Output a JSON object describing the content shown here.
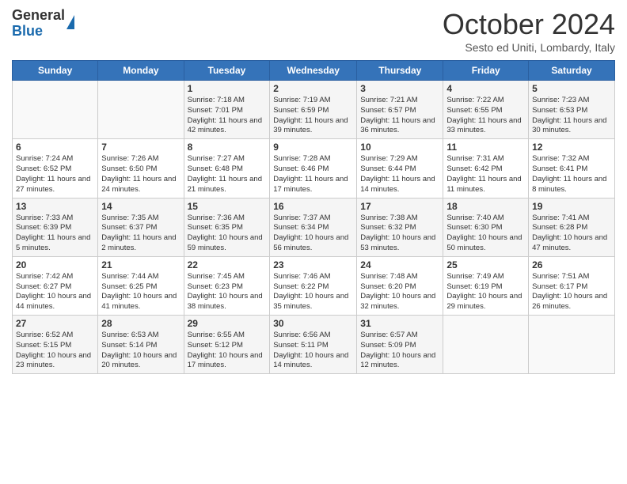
{
  "header": {
    "logo_general": "General",
    "logo_blue": "Blue",
    "month_title": "October 2024",
    "subtitle": "Sesto ed Uniti, Lombardy, Italy"
  },
  "days_of_week": [
    "Sunday",
    "Monday",
    "Tuesday",
    "Wednesday",
    "Thursday",
    "Friday",
    "Saturday"
  ],
  "weeks": [
    [
      {
        "day": "",
        "info": ""
      },
      {
        "day": "",
        "info": ""
      },
      {
        "day": "1",
        "info": "Sunrise: 7:18 AM\nSunset: 7:01 PM\nDaylight: 11 hours and 42 minutes."
      },
      {
        "day": "2",
        "info": "Sunrise: 7:19 AM\nSunset: 6:59 PM\nDaylight: 11 hours and 39 minutes."
      },
      {
        "day": "3",
        "info": "Sunrise: 7:21 AM\nSunset: 6:57 PM\nDaylight: 11 hours and 36 minutes."
      },
      {
        "day": "4",
        "info": "Sunrise: 7:22 AM\nSunset: 6:55 PM\nDaylight: 11 hours and 33 minutes."
      },
      {
        "day": "5",
        "info": "Sunrise: 7:23 AM\nSunset: 6:53 PM\nDaylight: 11 hours and 30 minutes."
      }
    ],
    [
      {
        "day": "6",
        "info": "Sunrise: 7:24 AM\nSunset: 6:52 PM\nDaylight: 11 hours and 27 minutes."
      },
      {
        "day": "7",
        "info": "Sunrise: 7:26 AM\nSunset: 6:50 PM\nDaylight: 11 hours and 24 minutes."
      },
      {
        "day": "8",
        "info": "Sunrise: 7:27 AM\nSunset: 6:48 PM\nDaylight: 11 hours and 21 minutes."
      },
      {
        "day": "9",
        "info": "Sunrise: 7:28 AM\nSunset: 6:46 PM\nDaylight: 11 hours and 17 minutes."
      },
      {
        "day": "10",
        "info": "Sunrise: 7:29 AM\nSunset: 6:44 PM\nDaylight: 11 hours and 14 minutes."
      },
      {
        "day": "11",
        "info": "Sunrise: 7:31 AM\nSunset: 6:42 PM\nDaylight: 11 hours and 11 minutes."
      },
      {
        "day": "12",
        "info": "Sunrise: 7:32 AM\nSunset: 6:41 PM\nDaylight: 11 hours and 8 minutes."
      }
    ],
    [
      {
        "day": "13",
        "info": "Sunrise: 7:33 AM\nSunset: 6:39 PM\nDaylight: 11 hours and 5 minutes."
      },
      {
        "day": "14",
        "info": "Sunrise: 7:35 AM\nSunset: 6:37 PM\nDaylight: 11 hours and 2 minutes."
      },
      {
        "day": "15",
        "info": "Sunrise: 7:36 AM\nSunset: 6:35 PM\nDaylight: 10 hours and 59 minutes."
      },
      {
        "day": "16",
        "info": "Sunrise: 7:37 AM\nSunset: 6:34 PM\nDaylight: 10 hours and 56 minutes."
      },
      {
        "day": "17",
        "info": "Sunrise: 7:38 AM\nSunset: 6:32 PM\nDaylight: 10 hours and 53 minutes."
      },
      {
        "day": "18",
        "info": "Sunrise: 7:40 AM\nSunset: 6:30 PM\nDaylight: 10 hours and 50 minutes."
      },
      {
        "day": "19",
        "info": "Sunrise: 7:41 AM\nSunset: 6:28 PM\nDaylight: 10 hours and 47 minutes."
      }
    ],
    [
      {
        "day": "20",
        "info": "Sunrise: 7:42 AM\nSunset: 6:27 PM\nDaylight: 10 hours and 44 minutes."
      },
      {
        "day": "21",
        "info": "Sunrise: 7:44 AM\nSunset: 6:25 PM\nDaylight: 10 hours and 41 minutes."
      },
      {
        "day": "22",
        "info": "Sunrise: 7:45 AM\nSunset: 6:23 PM\nDaylight: 10 hours and 38 minutes."
      },
      {
        "day": "23",
        "info": "Sunrise: 7:46 AM\nSunset: 6:22 PM\nDaylight: 10 hours and 35 minutes."
      },
      {
        "day": "24",
        "info": "Sunrise: 7:48 AM\nSunset: 6:20 PM\nDaylight: 10 hours and 32 minutes."
      },
      {
        "day": "25",
        "info": "Sunrise: 7:49 AM\nSunset: 6:19 PM\nDaylight: 10 hours and 29 minutes."
      },
      {
        "day": "26",
        "info": "Sunrise: 7:51 AM\nSunset: 6:17 PM\nDaylight: 10 hours and 26 minutes."
      }
    ],
    [
      {
        "day": "27",
        "info": "Sunrise: 6:52 AM\nSunset: 5:15 PM\nDaylight: 10 hours and 23 minutes."
      },
      {
        "day": "28",
        "info": "Sunrise: 6:53 AM\nSunset: 5:14 PM\nDaylight: 10 hours and 20 minutes."
      },
      {
        "day": "29",
        "info": "Sunrise: 6:55 AM\nSunset: 5:12 PM\nDaylight: 10 hours and 17 minutes."
      },
      {
        "day": "30",
        "info": "Sunrise: 6:56 AM\nSunset: 5:11 PM\nDaylight: 10 hours and 14 minutes."
      },
      {
        "day": "31",
        "info": "Sunrise: 6:57 AM\nSunset: 5:09 PM\nDaylight: 10 hours and 12 minutes."
      },
      {
        "day": "",
        "info": ""
      },
      {
        "day": "",
        "info": ""
      }
    ]
  ]
}
